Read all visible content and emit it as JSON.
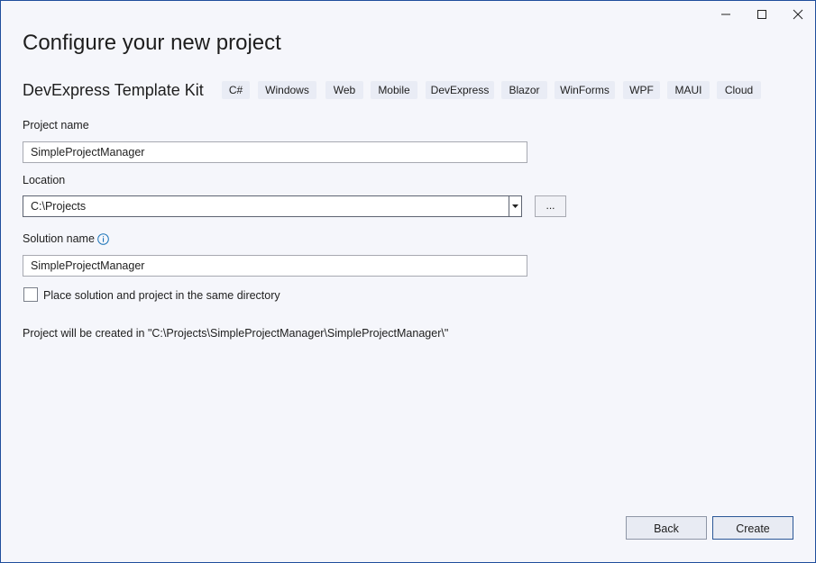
{
  "window": {
    "minimize_icon": "minimize-icon",
    "maximize_icon": "maximize-icon",
    "close_icon": "close-icon"
  },
  "title": "Configure your new project",
  "template": {
    "name": "DevExpress Template Kit",
    "tags": [
      "C#",
      "Windows",
      "Web",
      "Mobile",
      "DevExpress",
      "Blazor",
      "WinForms",
      "WPF",
      "MAUI",
      "Cloud"
    ]
  },
  "project_name": {
    "label": "Project name",
    "value": "SimpleProjectManager"
  },
  "location": {
    "label": "Location",
    "value": "C:\\Projects",
    "browse_label": "..."
  },
  "solution_name": {
    "label": "Solution name",
    "value": "SimpleProjectManager"
  },
  "same_directory": {
    "label": "Place solution and project in the same directory",
    "checked": false
  },
  "path_note": "Project will be created in \"C:\\Projects\\SimpleProjectManager\\SimpleProjectManager\\\"",
  "buttons": {
    "back": "Back",
    "create": "Create"
  },
  "colors": {
    "accent": "#2b5797",
    "info": "#1a73b8",
    "window_bg": "#f5f6fb",
    "tag_bg": "#e9ecf5"
  }
}
